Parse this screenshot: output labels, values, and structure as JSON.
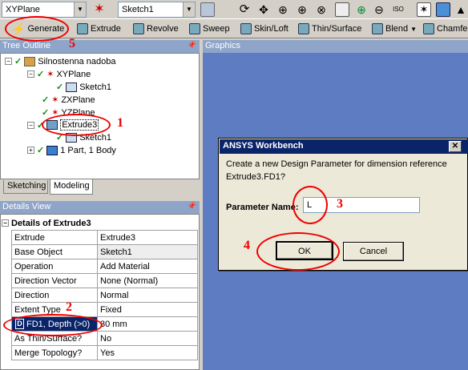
{
  "toolbar_top": {
    "plane_combo": "XYPlane",
    "sketch_combo": "Sketch1"
  },
  "toolbar_features": {
    "generate": "Generate",
    "extrude": "Extrude",
    "revolve": "Revolve",
    "sweep": "Sweep",
    "skinloft": "Skin/Loft",
    "thinsurface": "Thin/Surface",
    "blend": "Blend",
    "chamfer": "Chamfer"
  },
  "tree": {
    "title": "Tree Outline",
    "items": [
      "Silnostenna nadoba",
      "XYPlane",
      "Sketch1",
      "ZXPlane",
      "YZPlane",
      "Extrude3",
      "Sketch1",
      "1 Part, 1 Body"
    ],
    "tabs": [
      "Sketching",
      "Modeling"
    ]
  },
  "graphics": {
    "title": "Graphics"
  },
  "details": {
    "title": "Details View",
    "header": "Details of Extrude3",
    "rows": [
      [
        "Extrude",
        "Extrude3"
      ],
      [
        "Base Object",
        "Sketch1"
      ],
      [
        "Operation",
        "Add Material"
      ],
      [
        "Direction Vector",
        "None (Normal)"
      ],
      [
        "Direction",
        "Normal"
      ],
      [
        "Extent Type",
        "Fixed"
      ],
      [
        "FD1, Depth (>0)",
        "30 mm"
      ],
      [
        "As Thin/Surface?",
        "No"
      ],
      [
        "Merge Topology?",
        "Yes"
      ]
    ],
    "param_marker": "D"
  },
  "dialog": {
    "title": "ANSYS Workbench",
    "message_line1": "Create a new Design Parameter for dimension reference",
    "message_line2": "Extrude3.FD1?",
    "param_label": "Parameter Name:",
    "param_value": "L",
    "ok": "OK",
    "cancel": "Cancel"
  },
  "annotations": [
    "1",
    "2",
    "3",
    "4",
    "5"
  ],
  "colors": {
    "graphics_bg": "#5d7cc1",
    "panel_title_bg": "#8ea4c9",
    "annotation": "#e00000",
    "dialog_title_bg": "#0a246a"
  }
}
